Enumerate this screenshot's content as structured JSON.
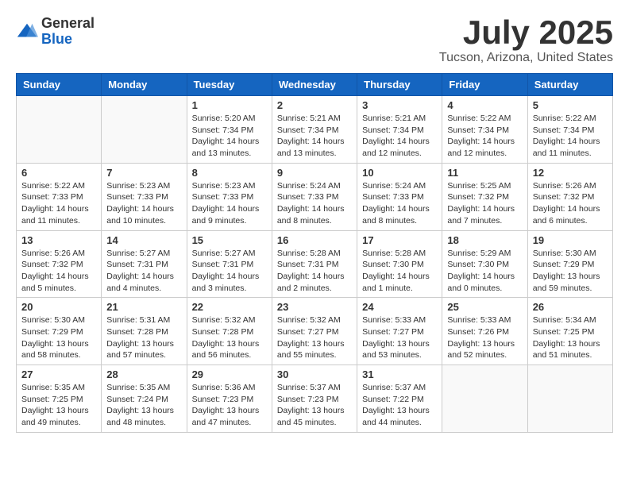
{
  "logo": {
    "general": "General",
    "blue": "Blue"
  },
  "title": "July 2025",
  "subtitle": "Tucson, Arizona, United States",
  "weekdays": [
    "Sunday",
    "Monday",
    "Tuesday",
    "Wednesday",
    "Thursday",
    "Friday",
    "Saturday"
  ],
  "weeks": [
    [
      {
        "day": "",
        "info": ""
      },
      {
        "day": "",
        "info": ""
      },
      {
        "day": "1",
        "info": "Sunrise: 5:20 AM\nSunset: 7:34 PM\nDaylight: 14 hours and 13 minutes."
      },
      {
        "day": "2",
        "info": "Sunrise: 5:21 AM\nSunset: 7:34 PM\nDaylight: 14 hours and 13 minutes."
      },
      {
        "day": "3",
        "info": "Sunrise: 5:21 AM\nSunset: 7:34 PM\nDaylight: 14 hours and 12 minutes."
      },
      {
        "day": "4",
        "info": "Sunrise: 5:22 AM\nSunset: 7:34 PM\nDaylight: 14 hours and 12 minutes."
      },
      {
        "day": "5",
        "info": "Sunrise: 5:22 AM\nSunset: 7:34 PM\nDaylight: 14 hours and 11 minutes."
      }
    ],
    [
      {
        "day": "6",
        "info": "Sunrise: 5:22 AM\nSunset: 7:33 PM\nDaylight: 14 hours and 11 minutes."
      },
      {
        "day": "7",
        "info": "Sunrise: 5:23 AM\nSunset: 7:33 PM\nDaylight: 14 hours and 10 minutes."
      },
      {
        "day": "8",
        "info": "Sunrise: 5:23 AM\nSunset: 7:33 PM\nDaylight: 14 hours and 9 minutes."
      },
      {
        "day": "9",
        "info": "Sunrise: 5:24 AM\nSunset: 7:33 PM\nDaylight: 14 hours and 8 minutes."
      },
      {
        "day": "10",
        "info": "Sunrise: 5:24 AM\nSunset: 7:33 PM\nDaylight: 14 hours and 8 minutes."
      },
      {
        "day": "11",
        "info": "Sunrise: 5:25 AM\nSunset: 7:32 PM\nDaylight: 14 hours and 7 minutes."
      },
      {
        "day": "12",
        "info": "Sunrise: 5:26 AM\nSunset: 7:32 PM\nDaylight: 14 hours and 6 minutes."
      }
    ],
    [
      {
        "day": "13",
        "info": "Sunrise: 5:26 AM\nSunset: 7:32 PM\nDaylight: 14 hours and 5 minutes."
      },
      {
        "day": "14",
        "info": "Sunrise: 5:27 AM\nSunset: 7:31 PM\nDaylight: 14 hours and 4 minutes."
      },
      {
        "day": "15",
        "info": "Sunrise: 5:27 AM\nSunset: 7:31 PM\nDaylight: 14 hours and 3 minutes."
      },
      {
        "day": "16",
        "info": "Sunrise: 5:28 AM\nSunset: 7:31 PM\nDaylight: 14 hours and 2 minutes."
      },
      {
        "day": "17",
        "info": "Sunrise: 5:28 AM\nSunset: 7:30 PM\nDaylight: 14 hours and 1 minute."
      },
      {
        "day": "18",
        "info": "Sunrise: 5:29 AM\nSunset: 7:30 PM\nDaylight: 14 hours and 0 minutes."
      },
      {
        "day": "19",
        "info": "Sunrise: 5:30 AM\nSunset: 7:29 PM\nDaylight: 13 hours and 59 minutes."
      }
    ],
    [
      {
        "day": "20",
        "info": "Sunrise: 5:30 AM\nSunset: 7:29 PM\nDaylight: 13 hours and 58 minutes."
      },
      {
        "day": "21",
        "info": "Sunrise: 5:31 AM\nSunset: 7:28 PM\nDaylight: 13 hours and 57 minutes."
      },
      {
        "day": "22",
        "info": "Sunrise: 5:32 AM\nSunset: 7:28 PM\nDaylight: 13 hours and 56 minutes."
      },
      {
        "day": "23",
        "info": "Sunrise: 5:32 AM\nSunset: 7:27 PM\nDaylight: 13 hours and 55 minutes."
      },
      {
        "day": "24",
        "info": "Sunrise: 5:33 AM\nSunset: 7:27 PM\nDaylight: 13 hours and 53 minutes."
      },
      {
        "day": "25",
        "info": "Sunrise: 5:33 AM\nSunset: 7:26 PM\nDaylight: 13 hours and 52 minutes."
      },
      {
        "day": "26",
        "info": "Sunrise: 5:34 AM\nSunset: 7:25 PM\nDaylight: 13 hours and 51 minutes."
      }
    ],
    [
      {
        "day": "27",
        "info": "Sunrise: 5:35 AM\nSunset: 7:25 PM\nDaylight: 13 hours and 49 minutes."
      },
      {
        "day": "28",
        "info": "Sunrise: 5:35 AM\nSunset: 7:24 PM\nDaylight: 13 hours and 48 minutes."
      },
      {
        "day": "29",
        "info": "Sunrise: 5:36 AM\nSunset: 7:23 PM\nDaylight: 13 hours and 47 minutes."
      },
      {
        "day": "30",
        "info": "Sunrise: 5:37 AM\nSunset: 7:23 PM\nDaylight: 13 hours and 45 minutes."
      },
      {
        "day": "31",
        "info": "Sunrise: 5:37 AM\nSunset: 7:22 PM\nDaylight: 13 hours and 44 minutes."
      },
      {
        "day": "",
        "info": ""
      },
      {
        "day": "",
        "info": ""
      }
    ]
  ]
}
